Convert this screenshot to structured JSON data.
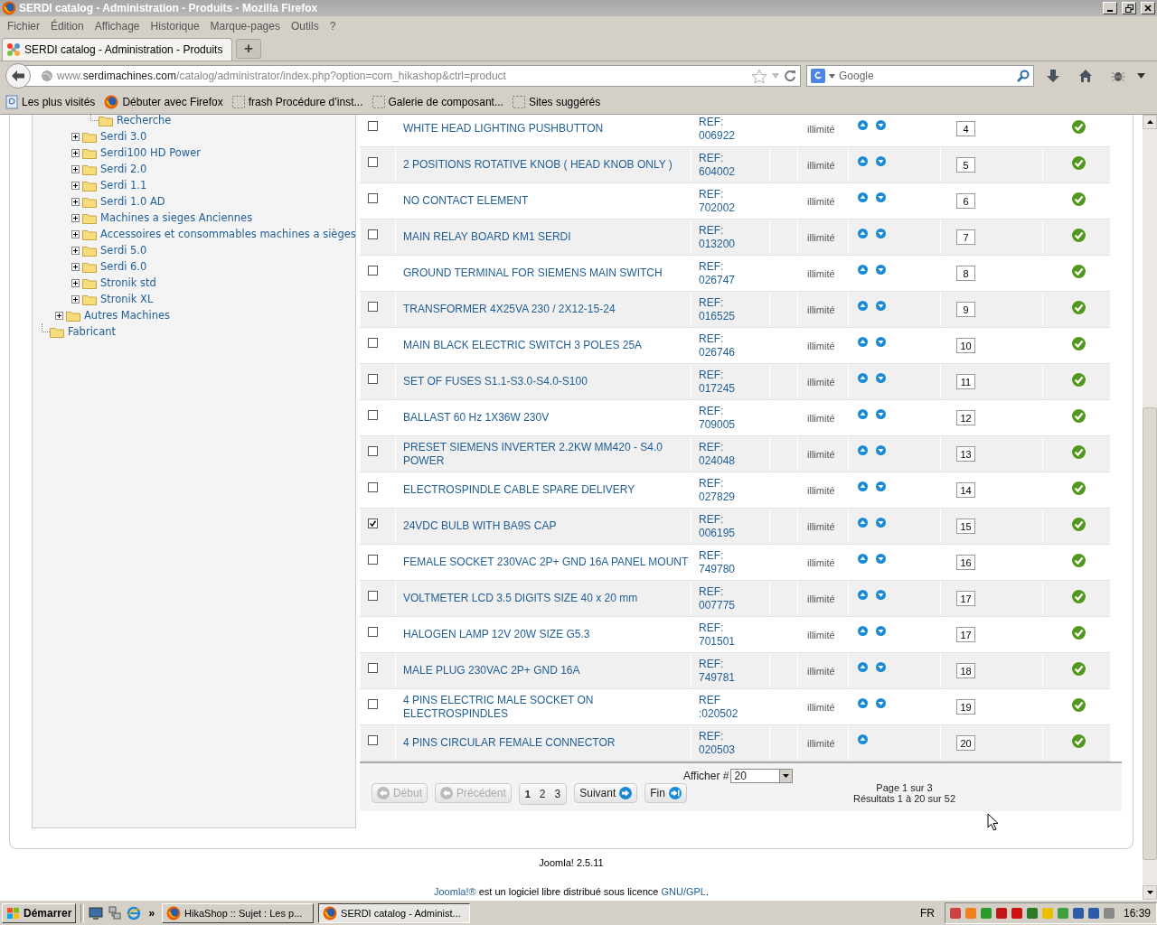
{
  "window": {
    "title": "SERDI catalog - Administration - Produits - Mozilla Firefox"
  },
  "menu": [
    "Fichier",
    "Édition",
    "Affichage",
    "Historique",
    "Marque-pages",
    "Outils",
    "?"
  ],
  "tabs": [
    {
      "label": "SERDI catalog - Administration - Produits",
      "selected": true
    }
  ],
  "new_tab": "+",
  "address_bar": {
    "prefix": "www.",
    "domain": "serdimachines.com",
    "path": "/catalog/administrator/index.php?option=com_hikashop&ctrl=product"
  },
  "search": {
    "placeholder": "Google"
  },
  "bookmarks": [
    {
      "label": "Les plus visités",
      "kind": "places"
    },
    {
      "label": "Débuter avec Firefox",
      "kind": "firefox"
    },
    {
      "label": "frash Procédure d’inst...",
      "kind": "blank"
    },
    {
      "label": "Galerie de composant...",
      "kind": "blank"
    },
    {
      "label": "Sites suggérés",
      "kind": "blank"
    }
  ],
  "tree": [
    {
      "children": [
        {
          "children": [
            {
              "children": [
                {
                  "label": "Recherche"
                }
              ]
            },
            {
              "label": "Serdi 3.0",
              "expanded": false
            },
            {
              "label": "Serdi100 HD Power",
              "expanded": false
            },
            {
              "label": "Serdi 2.0",
              "expanded": false
            },
            {
              "label": "Serdi 1.1",
              "expanded": false
            },
            {
              "label": "Serdi 1.0 AD",
              "expanded": false
            },
            {
              "label": "Machines a sieges Anciennes",
              "expanded": false
            },
            {
              "label": "Accessoires et consommables machines a sièges",
              "expanded": false
            },
            {
              "label": "Serdi 5.0",
              "expanded": false
            },
            {
              "label": "Serdi 6.0",
              "expanded": false
            },
            {
              "label": "Stronik std",
              "expanded": false
            },
            {
              "label": "Stronik XL",
              "expanded": false
            }
          ]
        },
        {
          "label": "Autres Machines",
          "expanded": false
        }
      ]
    },
    {
      "label": "Fabricant"
    }
  ],
  "products": [
    {
      "checked": false,
      "name": "WHITE HEAD LIGHTING PUSHBUTTON",
      "ref": "REF: 006922",
      "stock": "illimité",
      "up": true,
      "down": true,
      "ordering": "4",
      "published": true
    },
    {
      "checked": false,
      "name": "2 POSITIONS ROTATIVE KNOB ( HEAD KNOB ONLY )",
      "ref": "REF: 604002",
      "stock": "illimité",
      "up": true,
      "down": true,
      "ordering": "5",
      "published": true
    },
    {
      "checked": false,
      "name": "NO CONTACT ELEMENT",
      "ref": "REF: 702002",
      "stock": "illimité",
      "up": true,
      "down": true,
      "ordering": "6",
      "published": true
    },
    {
      "checked": false,
      "name": "MAIN RELAY BOARD KM1 SERDI",
      "ref": "REF: 013200",
      "stock": "illimité",
      "up": true,
      "down": true,
      "ordering": "7",
      "published": true
    },
    {
      "checked": false,
      "name": "GROUND TERMINAL FOR SIEMENS MAIN SWITCH",
      "ref": "REF: 026747",
      "stock": "illimité",
      "up": true,
      "down": true,
      "ordering": "8",
      "published": true
    },
    {
      "checked": false,
      "name": "TRANSFORMER 4X25VA 230 / 2X12-15-24",
      "ref": "REF: 016525",
      "stock": "illimité",
      "up": true,
      "down": true,
      "ordering": "9",
      "published": true
    },
    {
      "checked": false,
      "name": "MAIN BLACK ELECTRIC SWITCH 3 POLES 25A",
      "ref": "REF: 026746",
      "stock": "illimité",
      "up": true,
      "down": true,
      "ordering": "10",
      "published": true
    },
    {
      "checked": false,
      "name": "SET OF FUSES S1.1-S3.0-S4.0-S100",
      "ref": "REF: 017245",
      "stock": "illimité",
      "up": true,
      "down": true,
      "ordering": "11",
      "published": true
    },
    {
      "checked": false,
      "name": "BALLAST 60 Hz 1X36W 230V",
      "ref": "REF: 709005",
      "stock": "illimité",
      "up": true,
      "down": true,
      "ordering": "12",
      "published": true
    },
    {
      "checked": false,
      "name": "PRESET SIEMENS INVERTER 2.2KW MM420 - S4.0 POWER",
      "ref": "REF: 024048",
      "stock": "illimité",
      "up": true,
      "down": true,
      "ordering": "13",
      "published": true
    },
    {
      "checked": false,
      "name": "ELECTROSPINDLE CABLE SPARE DELIVERY",
      "ref": "REF: 027829",
      "stock": "illimité",
      "up": true,
      "down": true,
      "ordering": "14",
      "published": true
    },
    {
      "checked": true,
      "name": "24VDC BULB WITH BA9S CAP",
      "ref": "REF: 006195",
      "stock": "illimité",
      "up": true,
      "down": true,
      "ordering": "15",
      "published": true
    },
    {
      "checked": false,
      "name": "FEMALE SOCKET 230VAC 2P+ GND 16A PANEL MOUNT",
      "ref": "REF: 749780",
      "stock": "illimité",
      "up": true,
      "down": true,
      "ordering": "16",
      "published": true
    },
    {
      "checked": false,
      "name": "VOLTMETER LCD 3.5 DIGITS SIZE 40 x 20 mm",
      "ref": "REF: 007775",
      "stock": "illimité",
      "up": true,
      "down": true,
      "ordering": "17",
      "published": true
    },
    {
      "checked": false,
      "name": "HALOGEN LAMP 12V 20W SIZE G5.3",
      "ref": "REF: 701501",
      "stock": "illimité",
      "up": true,
      "down": true,
      "ordering": "17",
      "published": true
    },
    {
      "checked": false,
      "name": "MALE PLUG 230VAC 2P+ GND 16A",
      "ref": "REF: 749781",
      "stock": "illimité",
      "up": true,
      "down": true,
      "ordering": "18",
      "published": true
    },
    {
      "checked": false,
      "name": "4 PINS ELECTRIC MALE SOCKET ON ELECTROSPINDLES",
      "ref": "REF :020502",
      "stock": "illimité",
      "up": true,
      "down": true,
      "ordering": "19",
      "published": true
    },
    {
      "checked": false,
      "name": "4 PINS CIRCULAR FEMALE CONNECTOR",
      "ref": "REF: 020503",
      "stock": "illimité",
      "up": true,
      "down": false,
      "ordering": "20",
      "published": true
    }
  ],
  "pagination": {
    "limit_label": "Afficher #",
    "limit": "20",
    "buttons": [
      {
        "label": "Début",
        "kind": "start",
        "disabled": true
      },
      {
        "label": "Précédent",
        "kind": "prev",
        "disabled": true
      },
      {
        "kind": "pages",
        "pages": [
          {
            "label": "1",
            "selected": true
          },
          {
            "label": "2",
            "selected": false
          },
          {
            "label": "3",
            "selected": false
          }
        ]
      },
      {
        "label": "Suivant",
        "kind": "next",
        "disabled": false
      },
      {
        "label": "Fin",
        "kind": "end",
        "disabled": false
      }
    ],
    "page_info": "Page 1 sur 3",
    "results": "Résultats 1 à 20 sur 52"
  },
  "footer": {
    "version": "Joomla! 2.5.11",
    "link_1": "Joomla!®",
    "text": " est un logiciel libre distribué sous licence ",
    "link_2": "GNU/GPL",
    "end": "."
  },
  "taskbar": {
    "start": "Démarrer",
    "more": "»",
    "tasks": [
      {
        "label": "HikaShop :: Sujet : Les p...",
        "selected": false
      },
      {
        "label": "SERDI catalog - Administ...",
        "selected": true
      }
    ],
    "language": "FR",
    "clock": "16:39"
  }
}
